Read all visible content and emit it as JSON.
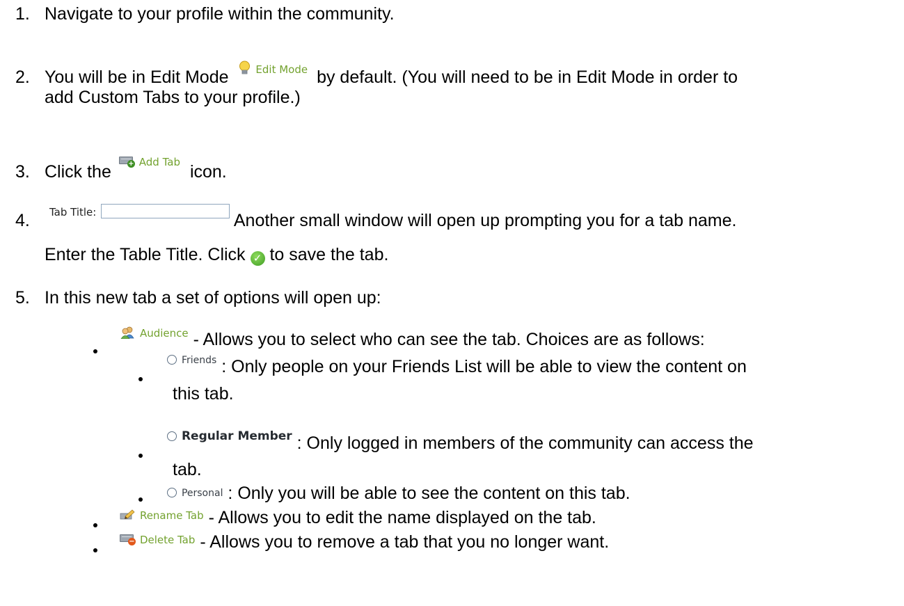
{
  "steps": [
    {
      "num": "1.",
      "text": "Navigate to your profile within the community."
    },
    {
      "num": "2.",
      "pre": "You will be in Edit Mode",
      "icon_label": "Edit Mode",
      "post": "by default. (You will need to be in Edit Mode in order to",
      "line2": "add Custom Tabs to your profile.)"
    },
    {
      "num": "3.",
      "pre": "Click the",
      "icon_label": "Add Tab",
      "post": "icon."
    },
    {
      "num": "4.",
      "field_label": "Tab Title:",
      "post": "Another small window will open up prompting you for a tab name.",
      "line2_pre": "Enter the Table Title.  Click",
      "line2_post": "to save the tab."
    },
    {
      "num": "5.",
      "text": "In this new tab a set of options will open up:"
    }
  ],
  "options": {
    "audience": {
      "label": "Audience",
      "desc": "- Allows you to select who can see the tab.  Choices are as follows:"
    },
    "friends": {
      "label": "Friends",
      "desc": ": Only people on your Friends List will be able to view the content on",
      "desc2": "this tab."
    },
    "regular": {
      "label": "Regular Member",
      "desc": ": Only logged in members of the community can access the",
      "desc2": "tab."
    },
    "personal": {
      "label": "Personal",
      "desc": ": Only you will be able to see the content on this tab."
    },
    "rename": {
      "label": "Rename Tab",
      "desc": "- Allows you to edit the name displayed on the tab."
    },
    "delete": {
      "label": "Delete Tab",
      "desc": "- Allows you to remove a tab that you no longer want."
    }
  }
}
